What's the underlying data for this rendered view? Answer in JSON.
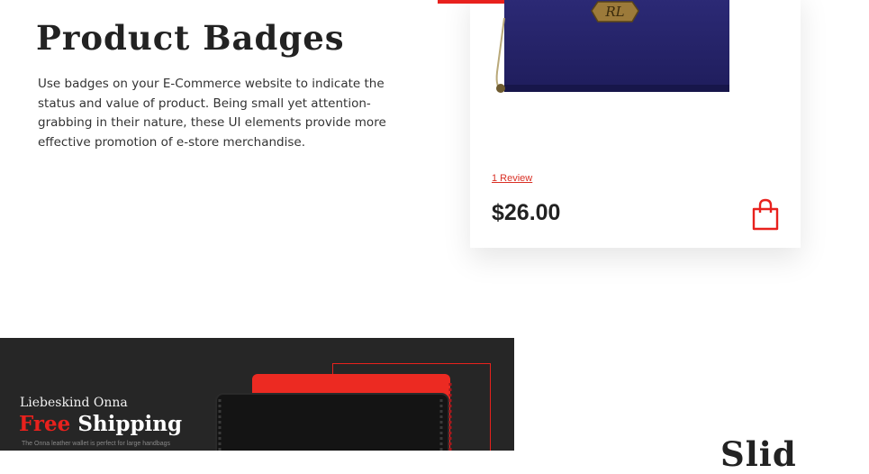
{
  "badges_section": {
    "title": "Product Badges",
    "description": "Use badges on your E-Commerce website to indicate the status and value of product. Being small yet attention-grabbing in their nature, these UI elements provide more effective promotion of e-store merchandise."
  },
  "product_card": {
    "image_icon": "wallet-product-image",
    "logo_text": "RL",
    "review_link": "1 Review",
    "price": "$26.00",
    "cart_icon": "shopping-bag-icon",
    "accent_color": "#e8211d"
  },
  "banner": {
    "kicker": "Liebeskind Onna",
    "headline_accent": "Free",
    "headline_rest": " Shipping",
    "caption": "The Onna leather wallet is perfect for large handbags",
    "background_color": "#262626"
  },
  "next_section": {
    "title_partial": "Slid"
  }
}
